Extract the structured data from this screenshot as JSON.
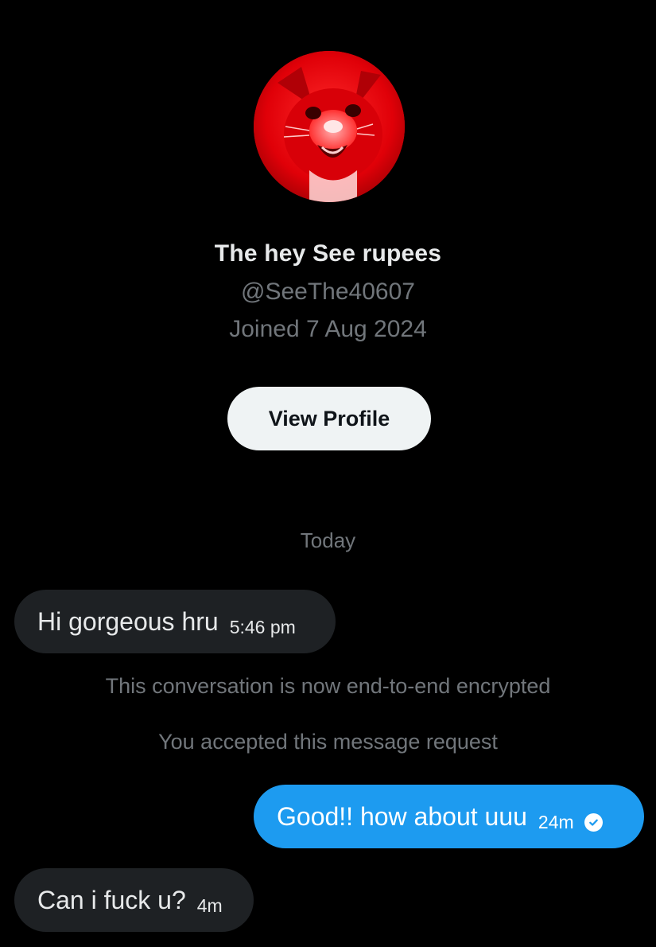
{
  "profile": {
    "avatar_icon": "red-cat-avatar-icon",
    "display_name": "The hey See rupees",
    "handle": "@SeeThe40607",
    "joined": "Joined 7 Aug 2024",
    "view_profile_label": "View Profile"
  },
  "conversation": {
    "date_separator": "Today",
    "system_messages": [
      "This conversation is now end-to-end encrypted",
      "You accepted this message request"
    ],
    "messages": [
      {
        "direction": "incoming",
        "text": "Hi gorgeous hru",
        "time": "5:46 pm"
      },
      {
        "direction": "outgoing",
        "text": "Good!! how about uuu",
        "time": "24m",
        "status_icon": "check-circle-icon"
      },
      {
        "direction": "incoming",
        "text": "Can i fuck u?",
        "time": "4m"
      }
    ]
  },
  "colors": {
    "background": "#000000",
    "incoming_bubble": "#1e2124",
    "outgoing_bubble": "#1d9bf0",
    "secondary_text": "#71767b",
    "button_bg": "#eff3f4"
  }
}
